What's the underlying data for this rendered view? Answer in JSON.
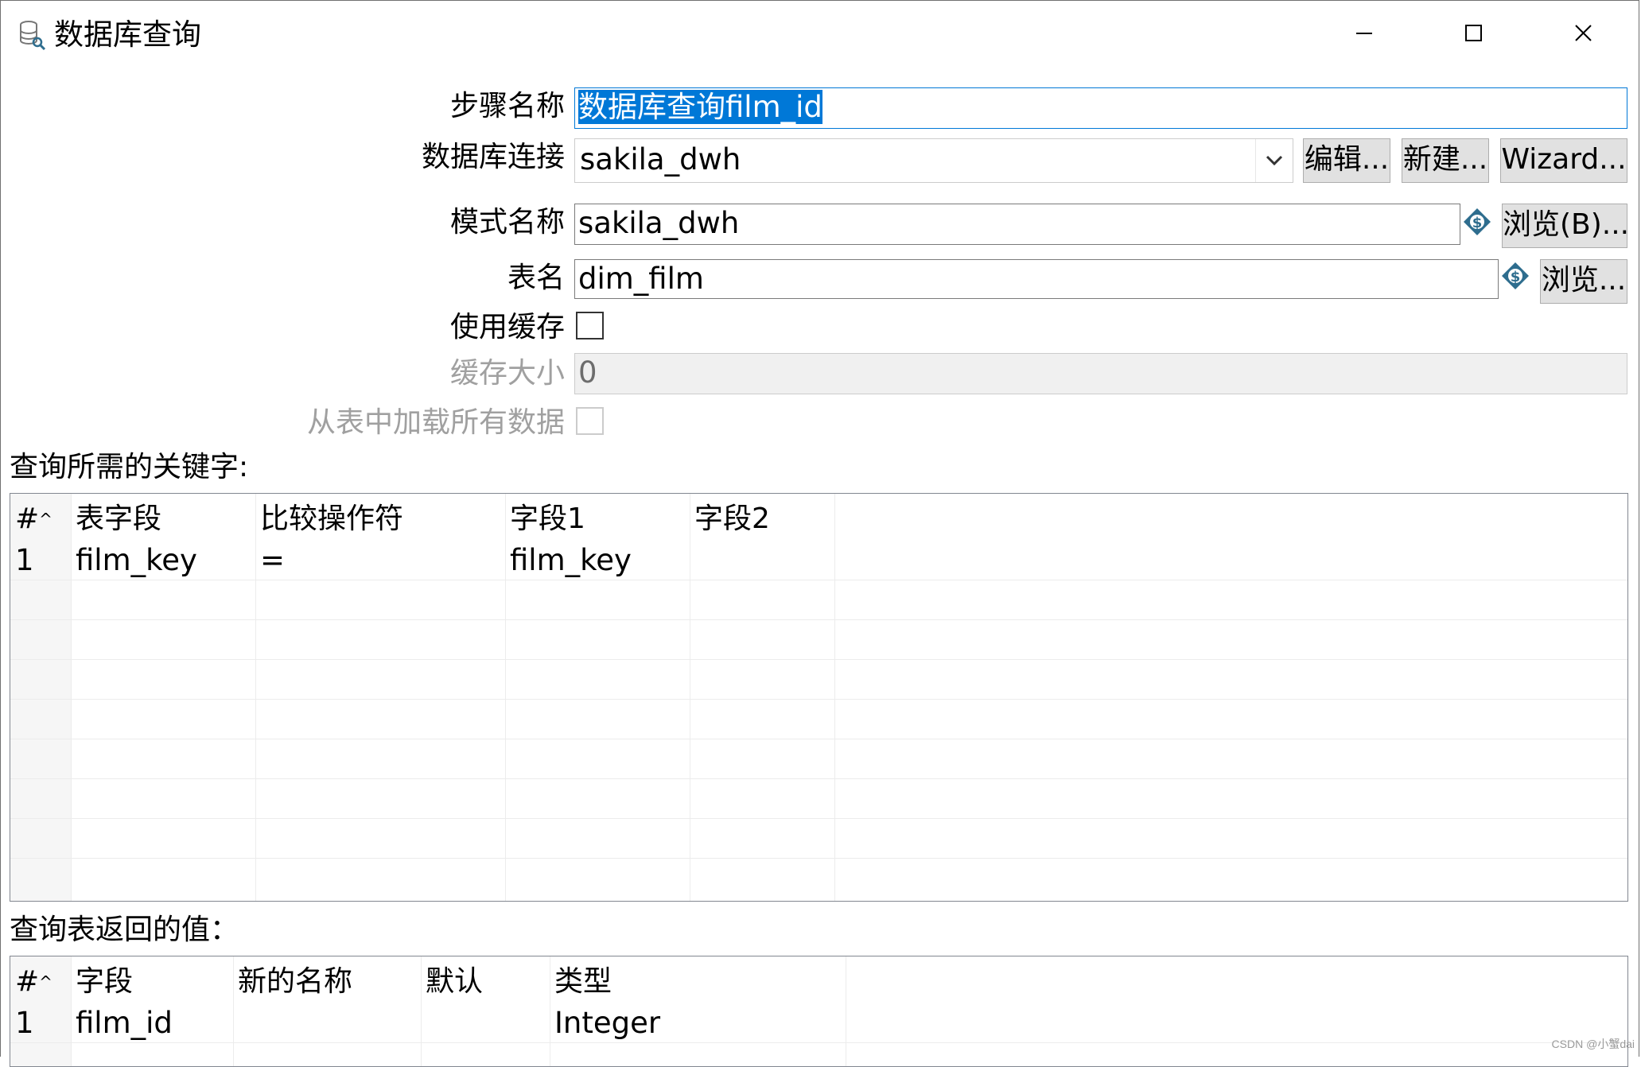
{
  "window": {
    "title": "数据库查询",
    "controls": [
      "minimize",
      "maximize",
      "close"
    ]
  },
  "form": {
    "step_name": {
      "label": "步骤名称",
      "value": "数据库查询film_id"
    },
    "db_connection": {
      "label": "数据库连接",
      "value": "sakila_dwh",
      "edit_button": "编辑...",
      "new_button": "新建...",
      "wizard_button": "Wizard..."
    },
    "schema": {
      "label": "模式名称",
      "value": "sakila_dwh",
      "browse_button": "浏览(B)..."
    },
    "table": {
      "label": "表名",
      "value": "dim_film",
      "browse_button": "浏览..."
    },
    "use_cache": {
      "label": "使用缓存",
      "checked": false
    },
    "cache_size": {
      "label": "缓存大小",
      "value": "0"
    },
    "load_all": {
      "label": "从表中加载所有数据",
      "checked": false
    }
  },
  "keys_section": {
    "title": "查询所需的关键字:",
    "columns": [
      "#",
      "表字段",
      "比较操作符",
      "字段1",
      "字段2"
    ],
    "rows": [
      {
        "num": "1",
        "table_field": "film_key",
        "operator": "=",
        "field1": "film_key",
        "field2": ""
      }
    ]
  },
  "returns_section": {
    "title": "查询表返回的值：",
    "columns": [
      "#",
      "字段",
      "新的名称",
      "默认",
      "类型"
    ],
    "rows": [
      {
        "num": "1",
        "field": "film_id",
        "new_name": "",
        "default": "",
        "type": "Integer"
      }
    ]
  },
  "watermark": "CSDN @小蟹dai",
  "colors": {
    "accent": "#0078d7",
    "button_bg": "#e1e1e1",
    "disabled_text": "#a0a0a0",
    "variable_icon": "#2e6d8e"
  }
}
